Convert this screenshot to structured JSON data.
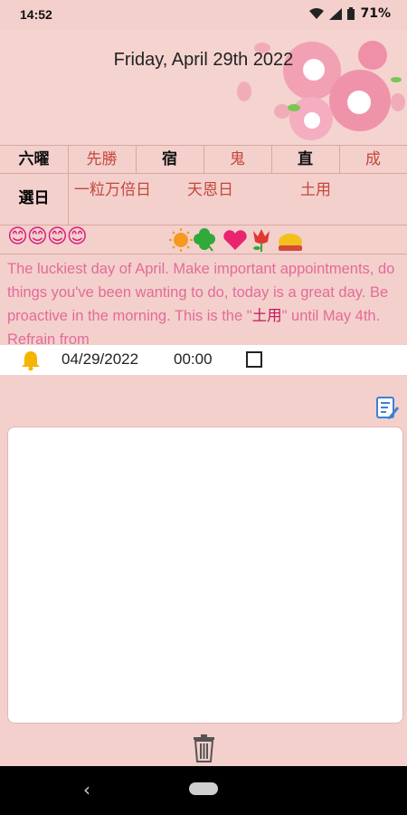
{
  "status_bar": {
    "time": "14:52",
    "battery": "71%"
  },
  "header": {
    "date_title": "Friday, April 29th 2022"
  },
  "table": {
    "row1": [
      {
        "label": "六曜",
        "value": "先勝"
      },
      {
        "label": "宿",
        "value": "鬼"
      },
      {
        "label": "直",
        "value": "成"
      }
    ],
    "row2": {
      "label": "選日",
      "values": [
        "一粒万倍日",
        "天恩日",
        "土用"
      ]
    }
  },
  "icons_row": {
    "smileys": "😊😊😊😊",
    "symbols": [
      "sun-icon",
      "clover-icon",
      "heart-icon",
      "tulip-icon",
      "money-bag-icon"
    ]
  },
  "fortune": {
    "text_before": "The luckiest day of April. Make important appointments, do things you've been wanting to do, today is a great day. Be proactive in the morning. This is the \"",
    "keyword": "土用",
    "text_after": "\" until May 4th. Refrain from"
  },
  "alarm": {
    "date": "04/29/2022",
    "time": "00:00",
    "checked": false
  },
  "notes": {
    "value": ""
  },
  "colors": {
    "background": "#f3d0cc",
    "accent_red": "#c5473c",
    "pink_text": "#e46a9a"
  }
}
